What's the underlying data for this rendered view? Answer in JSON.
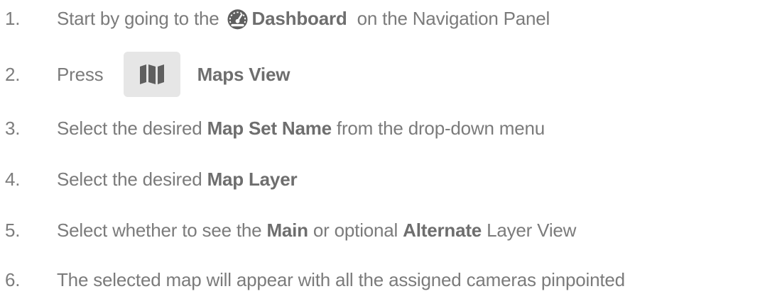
{
  "steps": [
    {
      "number": "1.",
      "parts": [
        "Start by going to the",
        "Dashboard",
        "on the Navigation Panel"
      ],
      "icon": "dashboard-gauge-icon"
    },
    {
      "number": "2.",
      "parts": [
        "Press",
        "Maps View"
      ],
      "icon": "map-icon"
    },
    {
      "number": "3.",
      "parts": [
        "Select the desired",
        "Map Set Name",
        "from the drop-down menu"
      ]
    },
    {
      "number": "4.",
      "parts": [
        "Select the desired",
        "Map Layer"
      ]
    },
    {
      "number": "5.",
      "parts": [
        "Select whether to see the",
        "Main",
        "or optional",
        "Alternate",
        "Layer View"
      ]
    },
    {
      "number": "6.",
      "parts": [
        "The selected map will appear with all the assigned cameras pinpointed"
      ]
    }
  ],
  "colors": {
    "text": "#7b7b7b",
    "bold_text": "#6e6e6e",
    "icon": "#5f5f5f",
    "button_bg": "#e6e6e6"
  }
}
